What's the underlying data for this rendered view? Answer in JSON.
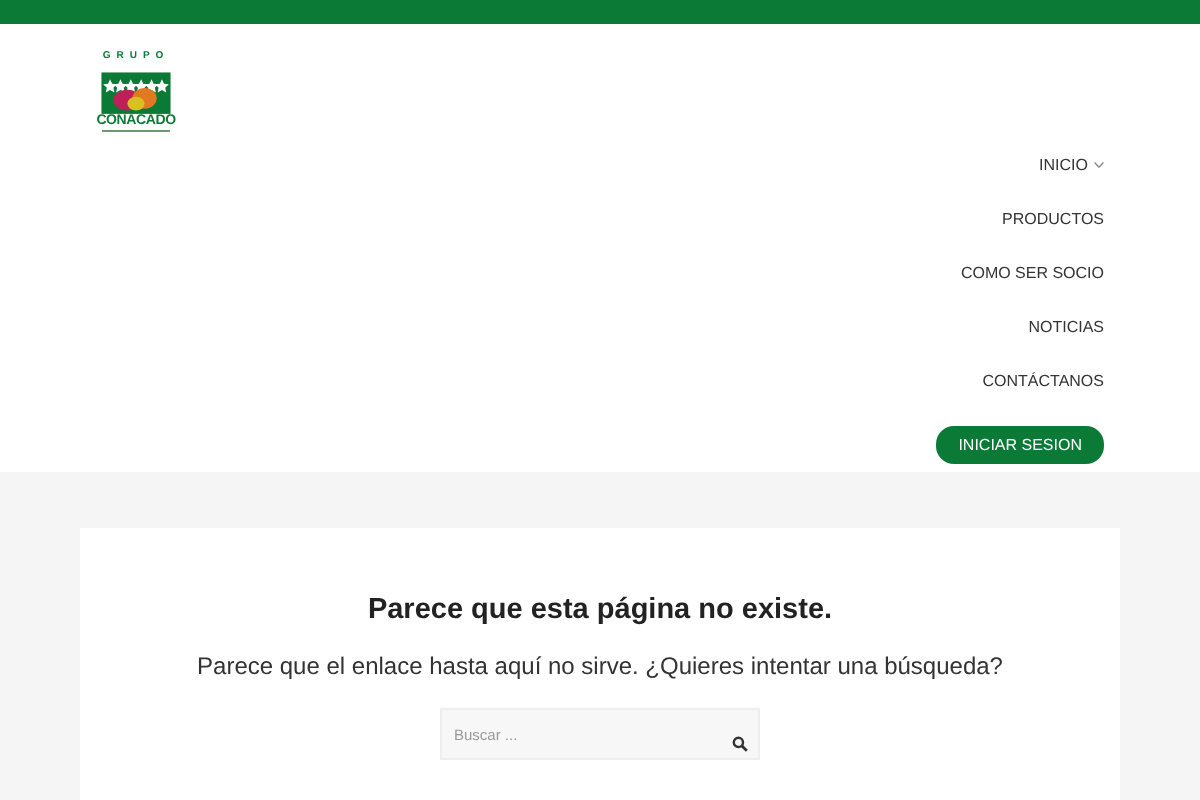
{
  "logo": {
    "top": "GRUPO",
    "name": "CONACADO"
  },
  "nav": {
    "items": [
      {
        "label": "INICIO",
        "has_submenu": true
      },
      {
        "label": "PRODUCTOS",
        "has_submenu": false
      },
      {
        "label": "COMO SER SOCIO",
        "has_submenu": false
      },
      {
        "label": "NOTICIAS",
        "has_submenu": false
      },
      {
        "label": "CONTÁCTANOS",
        "has_submenu": false
      }
    ],
    "button": "INICIAR SESION"
  },
  "error": {
    "title": "Parece que esta página no existe.",
    "message": "Parece que el enlace hasta aquí no sirve. ¿Quieres intentar una búsqueda?",
    "search": {
      "placeholder": "Buscar ..."
    }
  }
}
